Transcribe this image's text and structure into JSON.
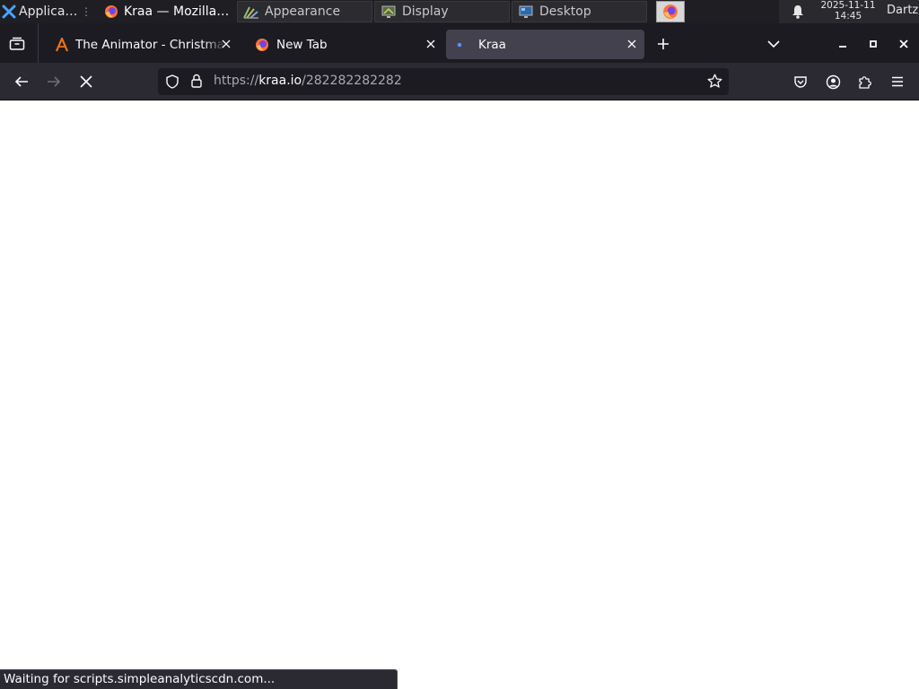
{
  "taskbar": {
    "applications_label": "Applications",
    "windows": [
      {
        "label": "Kraa — Mozilla F...",
        "icon": "firefox-icon",
        "active": true
      },
      {
        "label": "Appearance",
        "icon": "appearance-icon",
        "active": false
      },
      {
        "label": "Display",
        "icon": "display-icon",
        "active": false
      },
      {
        "label": "Desktop",
        "icon": "desktop-icon",
        "active": false
      }
    ],
    "clock": {
      "date": "2025-11-11",
      "time": "14:45"
    },
    "user": "Dartz"
  },
  "browser": {
    "tabs": [
      {
        "title": "The Animator - Christmas",
        "icon": "animator-icon",
        "selected": false
      },
      {
        "title": "New Tab",
        "icon": "firefox-icon",
        "selected": false
      },
      {
        "title": "Kraa",
        "icon": "loading-dot-icon",
        "selected": true
      }
    ],
    "url": {
      "scheme": "https://",
      "host": "kraa.io",
      "path": "/282282282282"
    },
    "status_text": "Waiting for scripts.simpleanalyticscdn.com..."
  },
  "colors": {
    "taskbar_bg": "#1f1f23",
    "tabstrip_bg": "#1c1b22",
    "toolbar_bg": "#2b2a33",
    "selected_tab_bg": "#42414d",
    "urlbar_bg": "#1c1b22",
    "content_bg": "#ffffff",
    "animator_orange": "#e8731c",
    "loading_blue": "#5b8cff"
  }
}
